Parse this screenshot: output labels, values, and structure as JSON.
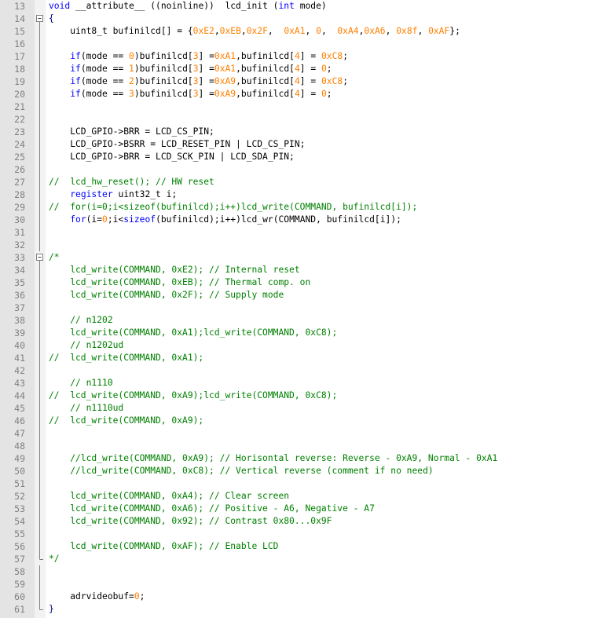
{
  "editor": {
    "colors": {
      "keyword": "#0000ff",
      "number": "#ff8000",
      "comment": "#008000",
      "operator": "#000080",
      "text": "#000000",
      "line_number": "#808080",
      "gutter": "#e4e4e4"
    },
    "lines": [
      {
        "n": "13",
        "fold": "",
        "code": [
          {
            "t": "kw",
            "v": "void"
          },
          {
            "t": "txt",
            "v": " __attribute__ ((noinline))  lcd_init ("
          },
          {
            "t": "kw",
            "v": "int"
          },
          {
            "t": "txt",
            "v": " mode)"
          }
        ]
      },
      {
        "n": "14",
        "fold": "open",
        "code": [
          {
            "t": "op",
            "v": "{"
          }
        ]
      },
      {
        "n": "15",
        "fold": "line",
        "code": [
          {
            "t": "txt",
            "v": "    uint8_t bufinilcd[] = {"
          },
          {
            "t": "num",
            "v": "0xE2"
          },
          {
            "t": "txt",
            "v": ","
          },
          {
            "t": "num",
            "v": "0xEB"
          },
          {
            "t": "txt",
            "v": ","
          },
          {
            "t": "num",
            "v": "0x2F"
          },
          {
            "t": "txt",
            "v": ",  "
          },
          {
            "t": "num",
            "v": "0xA1"
          },
          {
            "t": "txt",
            "v": ", "
          },
          {
            "t": "num",
            "v": "0"
          },
          {
            "t": "txt",
            "v": ",  "
          },
          {
            "t": "num",
            "v": "0xA4"
          },
          {
            "t": "txt",
            "v": ","
          },
          {
            "t": "num",
            "v": "0xA6"
          },
          {
            "t": "txt",
            "v": ", "
          },
          {
            "t": "num",
            "v": "0x8f"
          },
          {
            "t": "txt",
            "v": ", "
          },
          {
            "t": "num",
            "v": "0xAF"
          },
          {
            "t": "txt",
            "v": "};"
          }
        ]
      },
      {
        "n": "16",
        "fold": "line",
        "code": []
      },
      {
        "n": "17",
        "fold": "line",
        "code": [
          {
            "t": "txt",
            "v": "    "
          },
          {
            "t": "kw",
            "v": "if"
          },
          {
            "t": "txt",
            "v": "(mode == "
          },
          {
            "t": "num",
            "v": "0"
          },
          {
            "t": "txt",
            "v": ")bufinilcd["
          },
          {
            "t": "num",
            "v": "3"
          },
          {
            "t": "txt",
            "v": "] ="
          },
          {
            "t": "num",
            "v": "0xA1"
          },
          {
            "t": "txt",
            "v": ",bufinilcd["
          },
          {
            "t": "num",
            "v": "4"
          },
          {
            "t": "txt",
            "v": "] = "
          },
          {
            "t": "num",
            "v": "0xC8"
          },
          {
            "t": "txt",
            "v": ";"
          }
        ]
      },
      {
        "n": "18",
        "fold": "line",
        "code": [
          {
            "t": "txt",
            "v": "    "
          },
          {
            "t": "kw",
            "v": "if"
          },
          {
            "t": "txt",
            "v": "(mode == "
          },
          {
            "t": "num",
            "v": "1"
          },
          {
            "t": "txt",
            "v": ")bufinilcd["
          },
          {
            "t": "num",
            "v": "3"
          },
          {
            "t": "txt",
            "v": "] ="
          },
          {
            "t": "num",
            "v": "0xA1"
          },
          {
            "t": "txt",
            "v": ",bufinilcd["
          },
          {
            "t": "num",
            "v": "4"
          },
          {
            "t": "txt",
            "v": "] = "
          },
          {
            "t": "num",
            "v": "0"
          },
          {
            "t": "txt",
            "v": ";"
          }
        ]
      },
      {
        "n": "19",
        "fold": "line",
        "code": [
          {
            "t": "txt",
            "v": "    "
          },
          {
            "t": "kw",
            "v": "if"
          },
          {
            "t": "txt",
            "v": "(mode == "
          },
          {
            "t": "num",
            "v": "2"
          },
          {
            "t": "txt",
            "v": ")bufinilcd["
          },
          {
            "t": "num",
            "v": "3"
          },
          {
            "t": "txt",
            "v": "] ="
          },
          {
            "t": "num",
            "v": "0xA9"
          },
          {
            "t": "txt",
            "v": ",bufinilcd["
          },
          {
            "t": "num",
            "v": "4"
          },
          {
            "t": "txt",
            "v": "] = "
          },
          {
            "t": "num",
            "v": "0xC8"
          },
          {
            "t": "txt",
            "v": ";"
          }
        ]
      },
      {
        "n": "20",
        "fold": "line",
        "code": [
          {
            "t": "txt",
            "v": "    "
          },
          {
            "t": "kw",
            "v": "if"
          },
          {
            "t": "txt",
            "v": "(mode == "
          },
          {
            "t": "num",
            "v": "3"
          },
          {
            "t": "txt",
            "v": ")bufinilcd["
          },
          {
            "t": "num",
            "v": "3"
          },
          {
            "t": "txt",
            "v": "] ="
          },
          {
            "t": "num",
            "v": "0xA9"
          },
          {
            "t": "txt",
            "v": ",bufinilcd["
          },
          {
            "t": "num",
            "v": "4"
          },
          {
            "t": "txt",
            "v": "] = "
          },
          {
            "t": "num",
            "v": "0"
          },
          {
            "t": "txt",
            "v": ";"
          }
        ]
      },
      {
        "n": "21",
        "fold": "line",
        "code": []
      },
      {
        "n": "22",
        "fold": "line",
        "code": []
      },
      {
        "n": "23",
        "fold": "line",
        "code": [
          {
            "t": "txt",
            "v": "    LCD_GPIO->BRR = LCD_CS_PIN;"
          }
        ]
      },
      {
        "n": "24",
        "fold": "line",
        "code": [
          {
            "t": "txt",
            "v": "    LCD_GPIO->BSRR = LCD_RESET_PIN | LCD_CS_PIN;"
          }
        ]
      },
      {
        "n": "25",
        "fold": "line",
        "code": [
          {
            "t": "txt",
            "v": "    LCD_GPIO->BRR = LCD_SCK_PIN | LCD_SDA_PIN;"
          }
        ]
      },
      {
        "n": "26",
        "fold": "line",
        "code": []
      },
      {
        "n": "27",
        "fold": "line",
        "code": [
          {
            "t": "cmt",
            "v": "//  lcd_hw_reset(); // HW reset"
          }
        ]
      },
      {
        "n": "28",
        "fold": "line",
        "code": [
          {
            "t": "txt",
            "v": "    "
          },
          {
            "t": "kw",
            "v": "register"
          },
          {
            "t": "txt",
            "v": " uint32_t i;"
          }
        ]
      },
      {
        "n": "29",
        "fold": "line",
        "code": [
          {
            "t": "cmt",
            "v": "//  for(i=0;i<sizeof(bufinilcd);i++)lcd_write(COMMAND, bufinilcd[i]);"
          }
        ]
      },
      {
        "n": "30",
        "fold": "line",
        "code": [
          {
            "t": "txt",
            "v": "    "
          },
          {
            "t": "kw",
            "v": "for"
          },
          {
            "t": "txt",
            "v": "(i="
          },
          {
            "t": "num",
            "v": "0"
          },
          {
            "t": "txt",
            "v": ";i<"
          },
          {
            "t": "kw",
            "v": "sizeof"
          },
          {
            "t": "txt",
            "v": "(bufinilcd);i++)lcd_wr(COMMAND, bufinilcd[i]);"
          }
        ]
      },
      {
        "n": "31",
        "fold": "line",
        "code": []
      },
      {
        "n": "32",
        "fold": "line",
        "code": []
      },
      {
        "n": "33",
        "fold": "open",
        "code": [
          {
            "t": "cmt",
            "v": "/*"
          }
        ]
      },
      {
        "n": "34",
        "fold": "line",
        "code": [
          {
            "t": "cmt",
            "v": "    lcd_write(COMMAND, 0xE2); // Internal reset"
          }
        ]
      },
      {
        "n": "35",
        "fold": "line",
        "code": [
          {
            "t": "cmt",
            "v": "    lcd_write(COMMAND, 0xEB); // Thermal comp. on"
          }
        ]
      },
      {
        "n": "36",
        "fold": "line",
        "code": [
          {
            "t": "cmt",
            "v": "    lcd_write(COMMAND, 0x2F); // Supply mode"
          }
        ]
      },
      {
        "n": "37",
        "fold": "line",
        "code": []
      },
      {
        "n": "38",
        "fold": "line",
        "code": [
          {
            "t": "cmt",
            "v": "    // n1202"
          }
        ]
      },
      {
        "n": "39",
        "fold": "line",
        "code": [
          {
            "t": "cmt",
            "v": "    lcd_write(COMMAND, 0xA1);lcd_write(COMMAND, 0xC8);"
          }
        ]
      },
      {
        "n": "40",
        "fold": "line",
        "code": [
          {
            "t": "cmt",
            "v": "    // n1202ud"
          }
        ]
      },
      {
        "n": "41",
        "fold": "line",
        "code": [
          {
            "t": "cmt",
            "v": "//  lcd_write(COMMAND, 0xA1);"
          }
        ]
      },
      {
        "n": "42",
        "fold": "line",
        "code": []
      },
      {
        "n": "43",
        "fold": "line",
        "code": [
          {
            "t": "cmt",
            "v": "    // n1110"
          }
        ]
      },
      {
        "n": "44",
        "fold": "line",
        "code": [
          {
            "t": "cmt",
            "v": "//  lcd_write(COMMAND, 0xA9);lcd_write(COMMAND, 0xC8);"
          }
        ]
      },
      {
        "n": "45",
        "fold": "line",
        "code": [
          {
            "t": "cmt",
            "v": "    // n1110ud"
          }
        ]
      },
      {
        "n": "46",
        "fold": "line",
        "code": [
          {
            "t": "cmt",
            "v": "//  lcd_write(COMMAND, 0xA9);"
          }
        ]
      },
      {
        "n": "47",
        "fold": "line",
        "code": []
      },
      {
        "n": "48",
        "fold": "line",
        "code": []
      },
      {
        "n": "49",
        "fold": "line",
        "code": [
          {
            "t": "cmt",
            "v": "    //lcd_write(COMMAND, 0xA9); // Horisontal reverse: Reverse - 0xA9, Normal - 0xA1"
          }
        ]
      },
      {
        "n": "50",
        "fold": "line",
        "code": [
          {
            "t": "cmt",
            "v": "    //lcd_write(COMMAND, 0xC8); // Vertical reverse (comment if no need)"
          }
        ]
      },
      {
        "n": "51",
        "fold": "line",
        "code": []
      },
      {
        "n": "52",
        "fold": "line",
        "code": [
          {
            "t": "cmt",
            "v": "    lcd_write(COMMAND, 0xA4); // Clear screen"
          }
        ]
      },
      {
        "n": "53",
        "fold": "line",
        "code": [
          {
            "t": "cmt",
            "v": "    lcd_write(COMMAND, 0xA6); // Positive - A6, Negative - A7"
          }
        ]
      },
      {
        "n": "54",
        "fold": "line",
        "code": [
          {
            "t": "cmt",
            "v": "    lcd_write(COMMAND, 0x92); // Contrast 0x80...0x9F"
          }
        ]
      },
      {
        "n": "55",
        "fold": "line",
        "code": []
      },
      {
        "n": "56",
        "fold": "line",
        "code": [
          {
            "t": "cmt",
            "v": "    lcd_write(COMMAND, 0xAF); // Enable LCD"
          }
        ]
      },
      {
        "n": "57",
        "fold": "end",
        "code": [
          {
            "t": "cmt",
            "v": "*/"
          }
        ]
      },
      {
        "n": "58",
        "fold": "line",
        "code": []
      },
      {
        "n": "59",
        "fold": "line",
        "code": []
      },
      {
        "n": "60",
        "fold": "line",
        "code": [
          {
            "t": "txt",
            "v": "    adrvideobuf="
          },
          {
            "t": "num",
            "v": "0"
          },
          {
            "t": "txt",
            "v": ";"
          }
        ]
      },
      {
        "n": "61",
        "fold": "close",
        "code": [
          {
            "t": "op",
            "v": "}"
          }
        ]
      }
    ]
  }
}
